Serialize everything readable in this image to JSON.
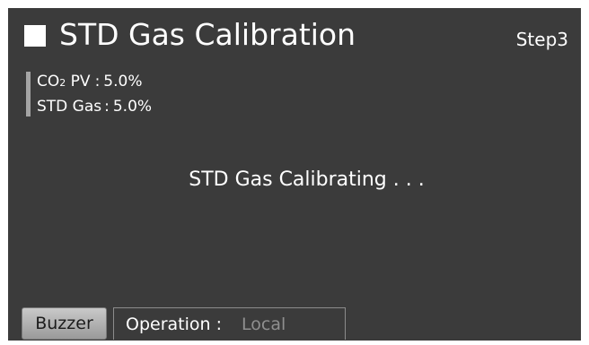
{
  "header": {
    "title": "STD Gas Calibration",
    "step": "Step3"
  },
  "readouts": [
    {
      "label_main": "CO",
      "label_sub": "2",
      "label_rest": " PV",
      "separator": ":",
      "value": "5.0%"
    },
    {
      "label_main": "STD Gas",
      "label_sub": "",
      "label_rest": "",
      "separator": ":",
      "value": "5.0%"
    }
  ],
  "status_message": "STD Gas Calibrating . . .",
  "footer": {
    "buzzer_label": "Buzzer",
    "operation_label": "Operation :",
    "operation_value": "Local"
  },
  "colors": {
    "screen_background": "#3b3b3b",
    "text": "#ffffff",
    "dimmed_value": "#8f8f8f",
    "readout_bar": "#a4a4a4"
  }
}
